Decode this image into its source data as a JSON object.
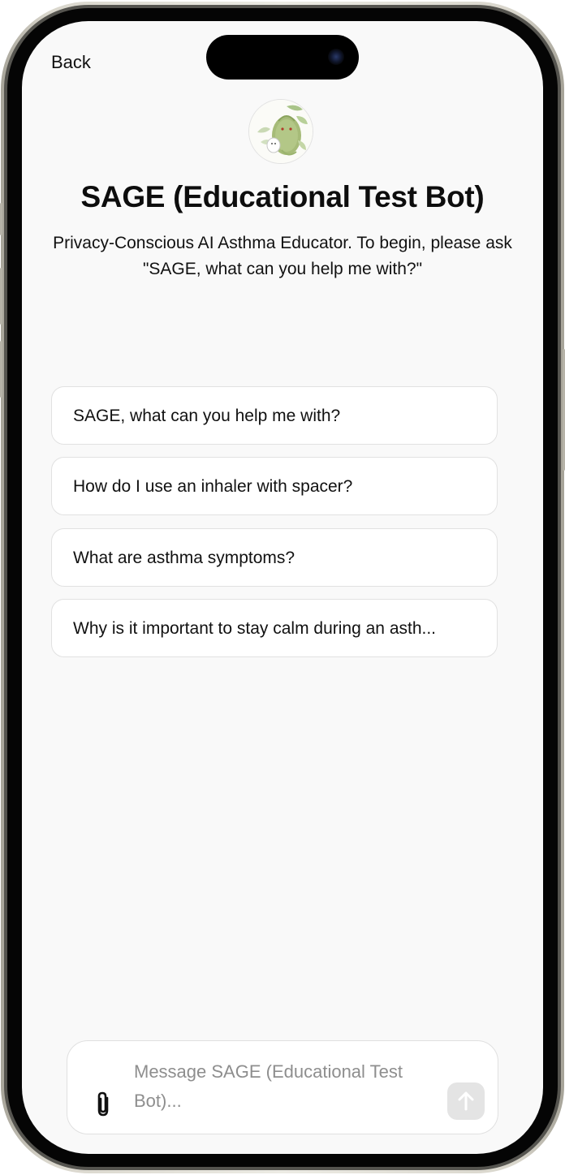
{
  "header": {
    "back_label": "Back"
  },
  "bot": {
    "avatar_icon": "leaf-creature-avatar",
    "name": "SAGE (Educational Test Bot)",
    "description": "Privacy-Conscious AI Asthma Educator. To begin, please ask \"SAGE, what can you help me with?\""
  },
  "prompts": [
    {
      "label": "SAGE, what can you help me with?"
    },
    {
      "label": "How do I use an inhaler with spacer?"
    },
    {
      "label": "What are asthma symptoms?"
    },
    {
      "label": "Why is it important to stay calm during an asth..."
    }
  ],
  "composer": {
    "placeholder": "Message SAGE (Educational Test Bot)...",
    "attach_icon": "paperclip-icon",
    "send_icon": "arrow-up-icon"
  },
  "colors": {
    "screen_bg": "#f9f9f9",
    "card_border": "#e1e1e1",
    "send_disabled_bg": "#e4e4e4"
  }
}
